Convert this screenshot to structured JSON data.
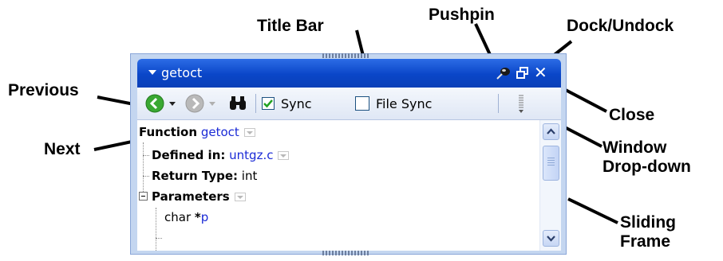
{
  "callouts": {
    "title_bar": "Title Bar",
    "pushpin": "Pushpin",
    "dock_undock": "Dock/Undock",
    "previous": "Previous",
    "close": "Close",
    "next": "Next",
    "window_dropdown_line1": "Window",
    "window_dropdown_line2": "Drop-down",
    "sliding_frame_line1": "Sliding",
    "sliding_frame_line2": "Frame"
  },
  "window": {
    "title": "getoct",
    "icons": {
      "title_menu": "triangle-down-icon",
      "pushpin": "pushpin-icon",
      "dock": "dock-undock-icon",
      "close": "close-icon"
    },
    "colors": {
      "title_bar": "#0a46c8",
      "frame": "#c4d6f0",
      "link": "#1a2ad6",
      "back_button": "#3aa832",
      "forward_button": "#b9b9b9"
    }
  },
  "toolbar": {
    "previous_icon": "green-left-arrow-icon",
    "next_icon": "gray-right-arrow-icon",
    "find_icon": "binoculars-icon",
    "sync_label": "Sync",
    "sync_checked": true,
    "file_sync_label": "File Sync",
    "file_sync_checked": false,
    "window_dropdown_icon": "window-dropdown-grip-icon"
  },
  "content": {
    "function_label": "Function",
    "function_name": "getoct",
    "defined_in_label": "Defined in:",
    "defined_in_value": "untgz.c",
    "return_type_label": "Return Type:",
    "return_type_value": "int",
    "parameters_label": "Parameters",
    "param_type": "char ",
    "param_pointer": "*",
    "param_name": "p"
  }
}
